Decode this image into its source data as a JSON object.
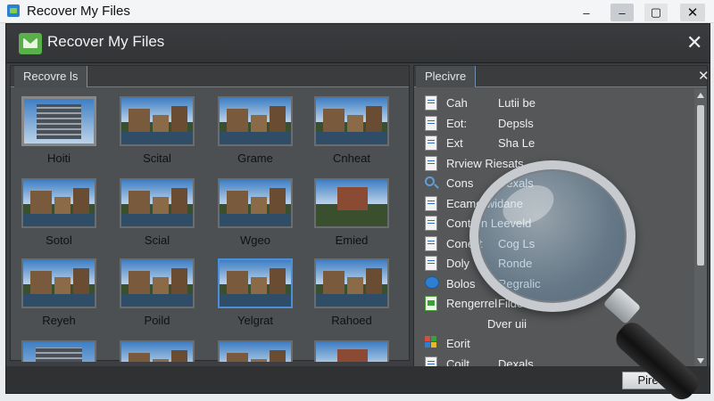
{
  "window": {
    "title": "Recover My Files",
    "controls": {
      "minimize": "–",
      "restore": "▢",
      "close": "✕"
    }
  },
  "app": {
    "title": "Recover My Files",
    "close": "✕"
  },
  "left_pane": {
    "tab": "Recovre ls",
    "thumbnails": [
      {
        "caption": "Hoiti",
        "style": "modern"
      },
      {
        "caption": "Scital",
        "style": "castle"
      },
      {
        "caption": "Grame",
        "style": "castle"
      },
      {
        "caption": "Cnheat",
        "style": "castle"
      },
      {
        "caption": "Sotol",
        "style": "castle"
      },
      {
        "caption": "Scial",
        "style": "castle"
      },
      {
        "caption": "Wgeo",
        "style": "castle"
      },
      {
        "caption": "Emied",
        "style": "house"
      },
      {
        "caption": "Reyeh",
        "style": "castle"
      },
      {
        "caption": "Poild",
        "style": "castle"
      },
      {
        "caption": "Yelgrat",
        "style": "castle"
      },
      {
        "caption": "Rahoed",
        "style": "castle"
      },
      {
        "caption": "",
        "style": "modern"
      },
      {
        "caption": "",
        "style": "castle"
      },
      {
        "caption": "",
        "style": "castle"
      },
      {
        "caption": "",
        "style": "house"
      }
    ]
  },
  "right_pane": {
    "tab": "Plecivre",
    "close": "✕",
    "rows": [
      {
        "icon": "document-icon",
        "col1": "Cah",
        "col2": "Lutii be"
      },
      {
        "icon": "document-icon",
        "col1": "Eot:",
        "col2": "Depsls"
      },
      {
        "icon": "document-icon",
        "col1": "Ext",
        "col2": "Sha Le"
      },
      {
        "icon": "document-icon",
        "col1": "Rrview Riesats",
        "col2": ""
      },
      {
        "icon": "search-icon",
        "col1": "Cons",
        "col2": "Dexals"
      },
      {
        "icon": "document-icon",
        "col1": "Ecame-widane",
        "col2": ""
      },
      {
        "icon": "document-icon",
        "col1": "Contern Leeveld",
        "col2": ""
      },
      {
        "icon": "document-icon",
        "col1": "Conelit",
        "col2": "Cog Ls"
      },
      {
        "icon": "document-icon",
        "col1": "Doly",
        "col2": "Ronde"
      },
      {
        "icon": "blue-globe-icon",
        "col1": "Bolos",
        "col2": "Regralic"
      },
      {
        "icon": "green-document-icon",
        "col1": "Rengerrel",
        "col2": "Filde A"
      },
      {
        "icon": "",
        "col1": "",
        "col2": "Dver uii"
      },
      {
        "icon": "multicolor-icon",
        "col1": "Eorit",
        "col2": ""
      },
      {
        "icon": "document-icon",
        "col1": "Coilt",
        "col2": "Dexals"
      }
    ]
  },
  "footer": {
    "button_label": "Pire"
  }
}
